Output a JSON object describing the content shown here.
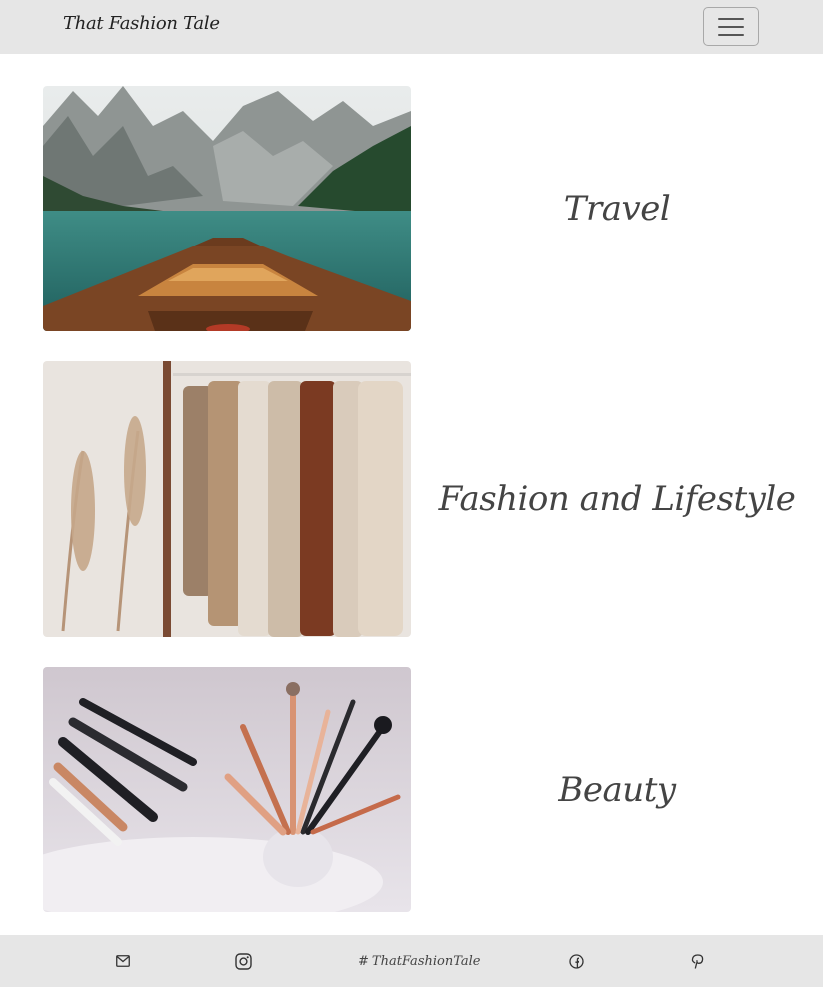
{
  "navbar": {
    "brand": "That Fashion Tale"
  },
  "categories": [
    {
      "label": "Travel",
      "image": "boat-lake-mountains-photo"
    },
    {
      "label": "Fashion and Lifestyle",
      "image": "clothing-rack-photo"
    },
    {
      "label": "Beauty",
      "image": "makeup-brushes-photo"
    }
  ],
  "footer": {
    "handle": "ThatFashionTale",
    "icons": [
      "mail-icon",
      "instagram-icon",
      "facebook-icon",
      "pinterest-icon"
    ]
  },
  "colors": {
    "bar": "#e6e6e6",
    "text": "#444444"
  }
}
